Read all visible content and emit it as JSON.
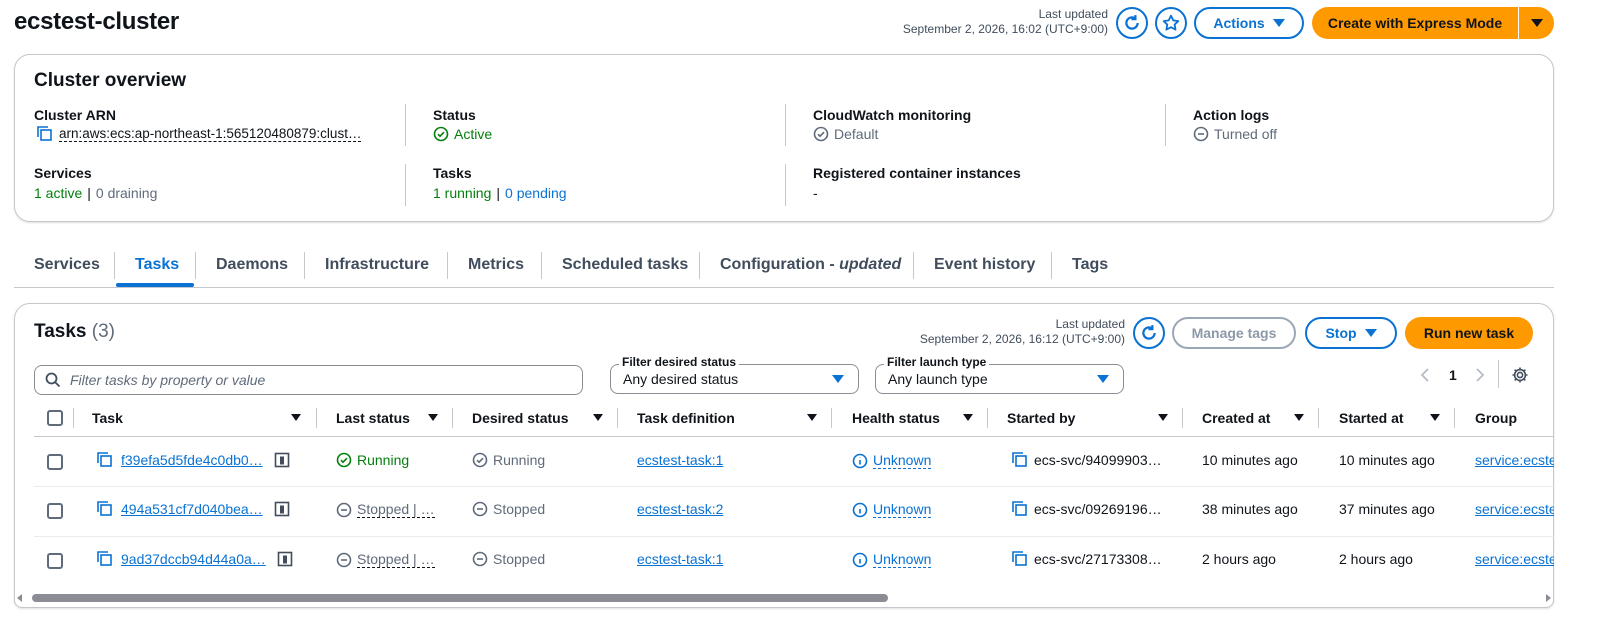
{
  "header": {
    "title": "ecstest-cluster",
    "last_updated_label": "Last updated",
    "last_updated_value": "September 2, 2026, 16:02 (UTC+9:00)",
    "actions_label": "Actions",
    "create_label": "Create with Express Mode"
  },
  "overview": {
    "title": "Cluster overview",
    "cluster_arn_label": "Cluster ARN",
    "cluster_arn_value": "arn:aws:ecs:ap-northeast-1:565120480879:clust…",
    "status_label": "Status",
    "status_value": "Active",
    "cloudwatch_label": "CloudWatch monitoring",
    "cloudwatch_value": "Default",
    "action_logs_label": "Action logs",
    "action_logs_value": "Turned off",
    "services_label": "Services",
    "services_active": "1 active",
    "services_sep": "|",
    "services_draining": "0 draining",
    "tasks_label": "Tasks",
    "tasks_running": "1 running",
    "tasks_sep": "|",
    "tasks_pending": "0 pending",
    "registered_label": "Registered container instances",
    "registered_value": "-"
  },
  "tabs": {
    "services": "Services",
    "tasks": "Tasks",
    "daemons": "Daemons",
    "infrastructure": "Infrastructure",
    "metrics": "Metrics",
    "scheduled": "Scheduled tasks",
    "configuration": "Configuration - ",
    "configuration_em": "updated",
    "event_history": "Event history",
    "tags": "Tags"
  },
  "tasks_panel": {
    "title": "Tasks",
    "count": "(3)",
    "last_updated_label": "Last updated",
    "last_updated_value": "September 2, 2026, 16:12 (UTC+9:00)",
    "manage_tags_label": "Manage tags",
    "stop_label": "Stop",
    "run_label": "Run new task",
    "search_placeholder": "Filter tasks by property or value",
    "filter_status_label": "Filter desired status",
    "filter_status_value": "Any desired status",
    "filter_launch_label": "Filter launch type",
    "filter_launch_value": "Any launch type",
    "page_number": "1"
  },
  "table": {
    "columns": [
      "Task",
      "Last status",
      "Desired status",
      "Task definition",
      "Health status",
      "Started by",
      "Created at",
      "Started at",
      "Group"
    ],
    "rows": [
      {
        "task": "f39efa5d5fde4c0db0…",
        "last_status": "Running",
        "desired_status": "Running",
        "task_definition": "ecstest-task:1",
        "health": "Unknown",
        "started_by": "ecs-svc/94099903…",
        "created_at": "10 minutes ago",
        "started_at": "10 minutes ago",
        "group": "service:ecste"
      },
      {
        "task": "494a531cf7d040bea…",
        "last_status": "Stopped | …",
        "desired_status": "Stopped",
        "task_definition": "ecstest-task:2",
        "health": "Unknown",
        "started_by": "ecs-svc/09269196…",
        "created_at": "38 minutes ago",
        "started_at": "37 minutes ago",
        "group": "service:ecste"
      },
      {
        "task": "9ad37dccb94d44a0a…",
        "last_status": "Stopped | …",
        "desired_status": "Stopped",
        "task_definition": "ecstest-task:1",
        "health": "Unknown",
        "started_by": "ecs-svc/27173308…",
        "created_at": "2 hours ago",
        "started_at": "2 hours ago",
        "group": "service:ecste"
      }
    ]
  },
  "colors": {
    "link": "#0972d3",
    "accent_orange": "#ff9900",
    "success": "#037f0c",
    "border": "#c6c6cd"
  },
  "icons": [
    "refresh-icon",
    "star-icon",
    "copy-icon",
    "check-circle-icon",
    "minus-circle-icon",
    "info-circle-icon",
    "task-details-icon",
    "settings-gear-icon",
    "chevron-left-icon",
    "chevron-right-icon",
    "search-icon"
  ]
}
